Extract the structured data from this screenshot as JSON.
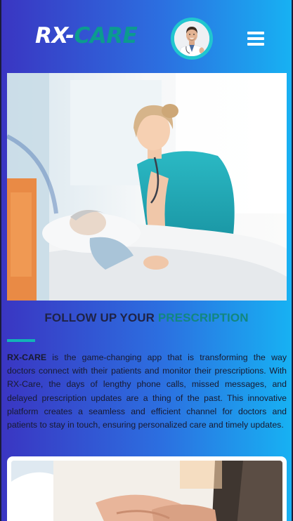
{
  "header": {
    "logo_primary": "RX-",
    "logo_accent": "CARE",
    "avatar_icon": "doctor-avatar",
    "menu_icon": "hamburger-menu-icon"
  },
  "hero": {
    "image": "nurse-caring-for-patient-photo"
  },
  "section": {
    "title_primary": "FOLLOW UP YOUR ",
    "title_accent": "PRESCRIPTION",
    "intro_brand": "RX-CARE",
    "intro_text": " is the game-changing app that is transforming the way doctors connect with their patients and monitor their prescriptions. With RX-Care, the days of lengthy phone calls, missed messages, and delayed prescription updates are a thing of the past. This innovative platform creates a seamless and efficient channel for doctors and patients to stay in touch, ensuring personalized care and timely updates."
  },
  "card": {
    "image": "doctor-holding-patient-hands-photo"
  },
  "colors": {
    "gradient_start": "#3a35c2",
    "gradient_end": "#17b2f3",
    "accent_teal": "#12877f",
    "avatar_ring": "#21c6cf"
  }
}
